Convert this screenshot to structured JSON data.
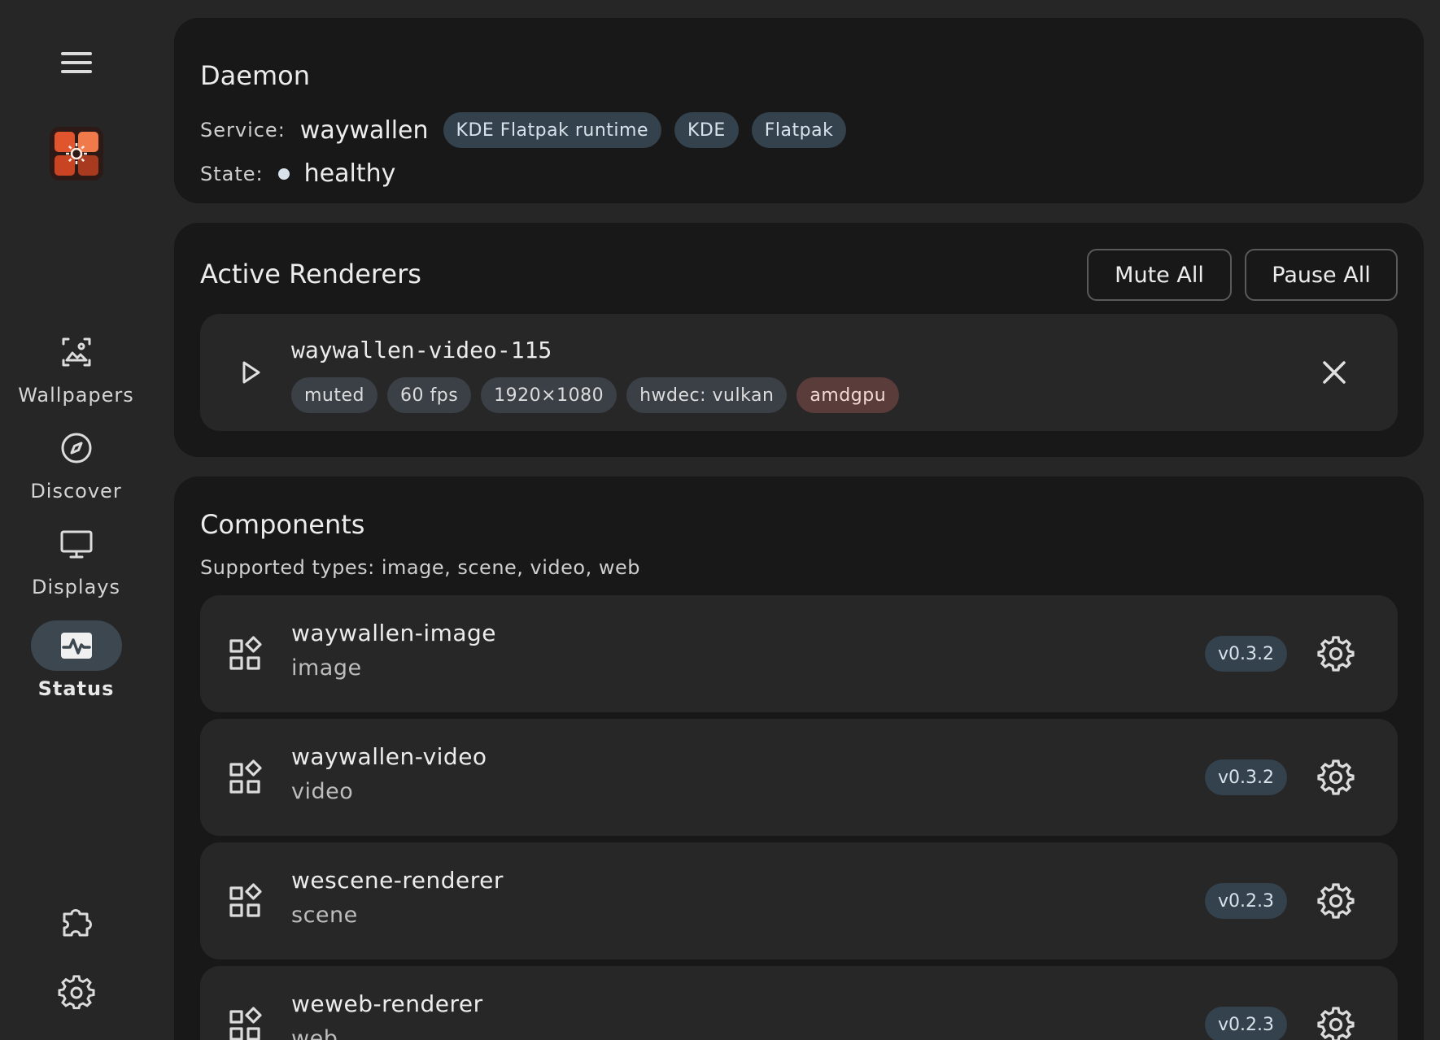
{
  "sidebar": {
    "menu_icon": "hamburger-menu-icon",
    "logo_icon": "app-logo-gear-icon",
    "nav": [
      {
        "label": "Wallpapers",
        "icon": "image-gallery-icon"
      },
      {
        "label": "Discover",
        "icon": "compass-icon"
      },
      {
        "label": "Displays",
        "icon": "monitor-icon"
      },
      {
        "label": "Status",
        "icon": "activity-pulse-icon",
        "active": true
      }
    ],
    "bottom_icons": [
      "puzzle-extensions-icon",
      "settings-gear-icon"
    ]
  },
  "daemon": {
    "title": "Daemon",
    "service_label": "Service:",
    "service_value": "waywallen",
    "service_tags": [
      "KDE Flatpak runtime",
      "KDE",
      "Flatpak"
    ],
    "state_label": "State:",
    "state_value": "healthy"
  },
  "renderers": {
    "title": "Active Renderers",
    "mute_all": "Mute All",
    "pause_all": "Pause All",
    "items": [
      {
        "name": "waywallen-video-115",
        "tags": [
          "muted",
          "60 fps",
          "1920×1080",
          "hwdec: vulkan",
          "amdgpu"
        ]
      }
    ]
  },
  "components": {
    "title": "Components",
    "subtitle": "Supported types: image, scene, video, web",
    "items": [
      {
        "name": "waywallen-image",
        "type": "image",
        "version": "v0.3.2"
      },
      {
        "name": "waywallen-video",
        "type": "video",
        "version": "v0.3.2"
      },
      {
        "name": "wescene-renderer",
        "type": "scene",
        "version": "v0.2.3"
      },
      {
        "name": "weweb-renderer",
        "type": "web",
        "version": "v0.2.3"
      }
    ]
  },
  "colors": {
    "background": "#262626",
    "card": "#181818",
    "item": "#272727",
    "tag": "#33424c",
    "warn_tag": "#5a3c3a",
    "logo": "#e0552e"
  }
}
